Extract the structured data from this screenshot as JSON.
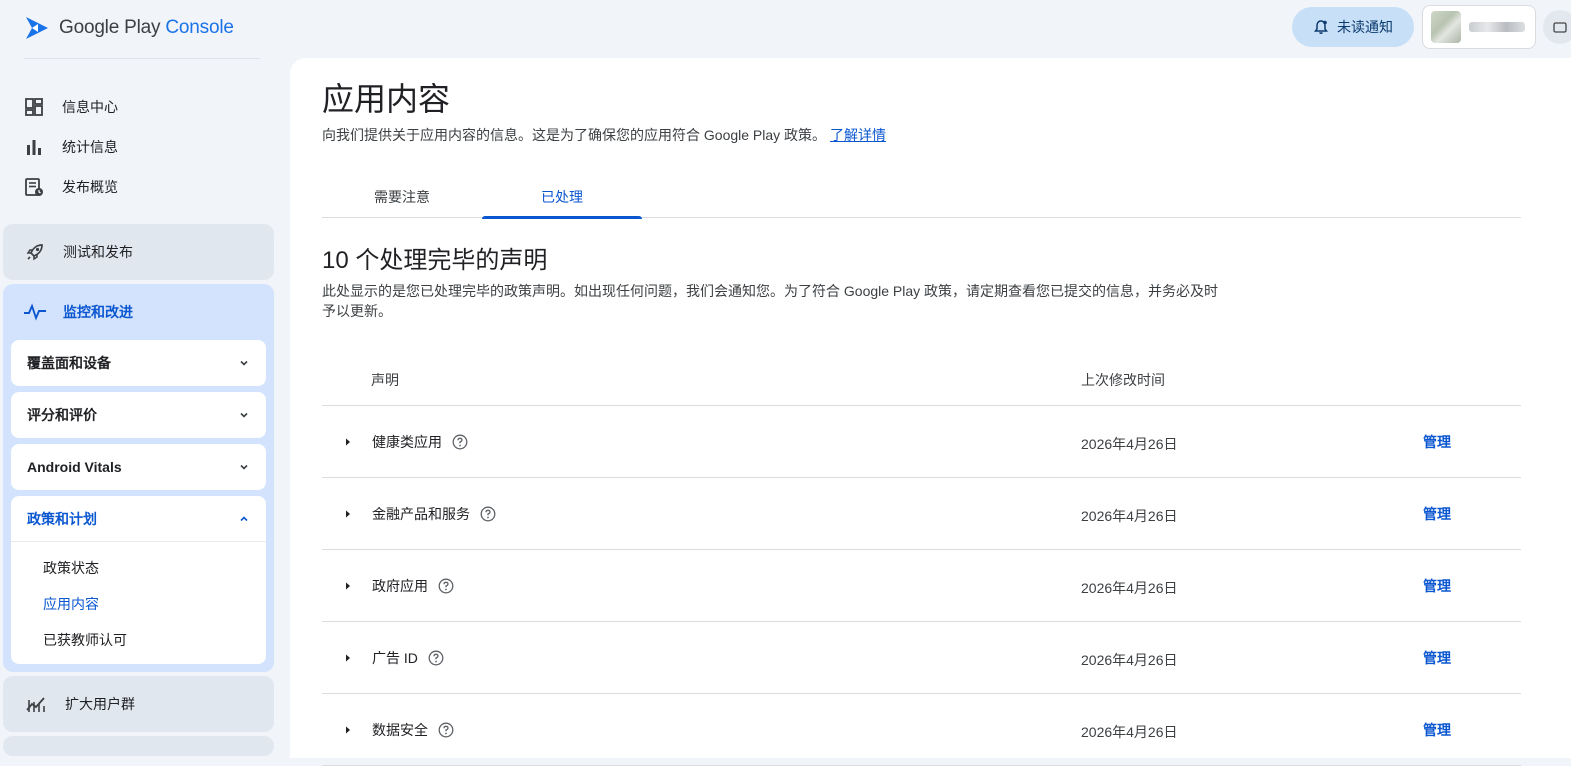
{
  "brand": {
    "name_part1": "Google Play ",
    "name_part2": "Console"
  },
  "header": {
    "notifications_label": "未读通知"
  },
  "sidebar": {
    "items": [
      {
        "label": "信息中心"
      },
      {
        "label": "统计信息"
      },
      {
        "label": "发布概览"
      }
    ],
    "test_release": "测试和发布",
    "monitor": {
      "label": "监控和改进",
      "groups": [
        {
          "label": "覆盖面和设备"
        },
        {
          "label": "评分和评价"
        },
        {
          "label": "Android Vitals"
        }
      ],
      "policy": {
        "label": "政策和计划",
        "links": [
          {
            "label": "政策状态"
          },
          {
            "label": "应用内容"
          },
          {
            "label": "已获教师认可"
          }
        ]
      }
    },
    "grow": "扩大用户群"
  },
  "main": {
    "title": "应用内容",
    "description": "向我们提供关于应用内容的信息。这是为了确保您的应用符合 Google Play 政策。",
    "learn_more": "了解详情",
    "tabs": [
      {
        "label": "需要注意"
      },
      {
        "label": "已处理"
      }
    ],
    "section_title": "10 个处理完毕的声明",
    "section_desc": "此处显示的是您已处理完毕的政策声明。如出现任何问题，我们会通知您。为了符合 Google Play 政策，请定期查看您已提交的信息，并务必及时予以更新。",
    "table": {
      "col_declaration": "声明",
      "col_modified": "上次修改时间",
      "rows": [
        {
          "name": "健康类应用",
          "date": "2026年4月26日",
          "action": "管理"
        },
        {
          "name": "金融产品和服务",
          "date": "2026年4月26日",
          "action": "管理"
        },
        {
          "name": "政府应用",
          "date": "2026年4月26日",
          "action": "管理"
        },
        {
          "name": "广告 ID",
          "date": "2026年4月26日",
          "action": "管理"
        },
        {
          "name": "数据安全",
          "date": "2026年4月26日",
          "action": "管理"
        }
      ]
    }
  }
}
